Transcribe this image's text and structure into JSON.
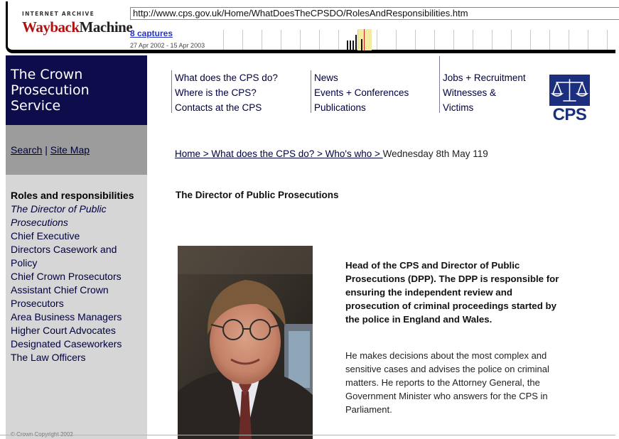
{
  "wayback": {
    "logo_top": "INTERNET ARCHIVE",
    "logo_main_1": "Wayback",
    "logo_main_2": "Machine",
    "url": "http://www.cps.gov.uk/Home/WhatDoesTheCPSDO/RolesAndResponsibilities.htm",
    "captures": "8 captures",
    "date_range": "27 Apr 2002 - 15 Apr 2003"
  },
  "site": {
    "title_line1": "The Crown",
    "title_line2": "Prosecution",
    "title_line3": "Service",
    "search": "Search",
    "separator": "|",
    "site_map": "Site Map",
    "nav": {
      "col1": [
        "What does the CPS do?",
        "Where is the CPS?",
        "Contacts at the CPS"
      ],
      "col2": [
        "News",
        "Events + Conferences",
        "Publications"
      ],
      "col3": [
        "Jobs + Recruitment",
        "Witnesses &",
        "Victims"
      ]
    },
    "logo_text": "CPS",
    "colors": {
      "navy": "#0d0d4c",
      "logo_blue": "#1c2f7e",
      "side_grey": "#d6d6d6",
      "search_grey": "#9c9c9c"
    }
  },
  "sidebar": {
    "heading": "Roles and responsibilities",
    "current_line1": "The Director of Public",
    "current_line2": "Prosecutions",
    "items": [
      "Chief Executive",
      "Directors Casework and Policy",
      "Chief Crown Prosecutors",
      "Assistant Chief Crown",
      "Prosecutors",
      "Area Business Managers",
      "Higher Court Advocates",
      "Designated Caseworkers",
      "The Law Officers"
    ],
    "copyright": "© Crown Copyright 2002"
  },
  "breadcrumb": {
    "home": "Home > ",
    "what": " What does the CPS do? > ",
    "who": " Who's who > ",
    "date": " Wednesday 8th May 119"
  },
  "content": {
    "title": "The Director of Public Prosecutions",
    "lead": "Head of the CPS and Director of Public Prosecutions (DPP). The DPP is responsible for ensuring the independent review and prosecution of criminal proceedings started by the police in England and Wales.",
    "body": "He makes decisions about the most complex and sensitive cases and advises the police on criminal matters. He reports to the Attorney General, the Government Minister who answers for the CPS in Parliament."
  }
}
